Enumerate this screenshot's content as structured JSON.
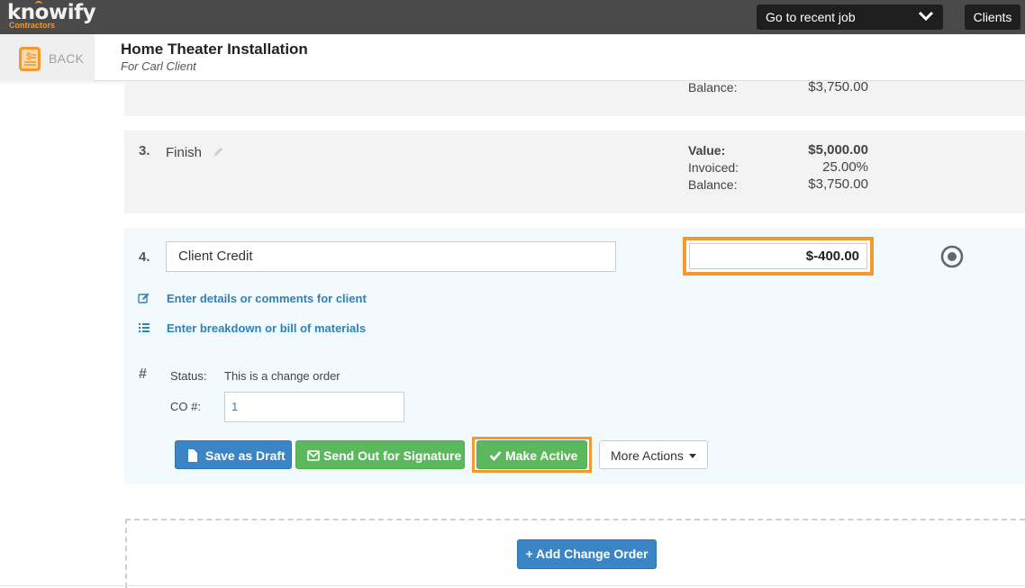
{
  "app": {
    "logo_text": "knowify",
    "logo_sub": "Contractors"
  },
  "topbar": {
    "recent_job_label": "Go to recent job",
    "clients_label": "Clients"
  },
  "header": {
    "back_label": "BACK",
    "title": "Home Theater Installation",
    "subtitle": "For Carl Client"
  },
  "item2": {
    "balance_label": "Balance:",
    "balance_value": "$3,750.00"
  },
  "item3": {
    "number": "3.",
    "name": "Finish",
    "value_label": "Value:",
    "value": "$5,000.00",
    "invoiced_label": "Invoiced:",
    "invoiced": "25.00%",
    "balance_label": "Balance:",
    "balance": "$3,750.00"
  },
  "item4": {
    "number": "4.",
    "name": "Client Credit",
    "amount": "$-400.00",
    "details_link": "Enter details or comments for client",
    "breakdown_link": "Enter breakdown or bill of materials",
    "hash": "#",
    "status_label": "Status:",
    "status_value": "This is a change order",
    "co_label": "CO #:",
    "co_value": "1",
    "buttons": {
      "save_draft": "Save as Draft",
      "send_signature": "Send Out for Signature",
      "make_active": "Make Active",
      "more_actions": "More Actions"
    }
  },
  "add_change_order": "+ Add Change Order",
  "colors": {
    "accent": "#f29a2e",
    "primary": "#3a85c6",
    "success": "#5cb85c",
    "link": "#2f82b8",
    "topbar": "#4a4a4a"
  }
}
